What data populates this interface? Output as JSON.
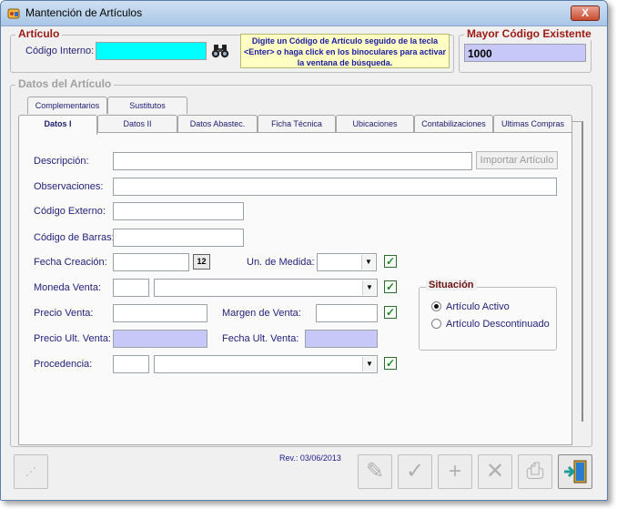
{
  "window": {
    "title": "Mantención de Artículos",
    "close_label": "X"
  },
  "articulo": {
    "group_title": "Artículo",
    "codigo_interno_label": "Código Interno:",
    "codigo_interno_value": "",
    "hint": "Digite un Código de Artículo seguido de la tecla <Enter> o haga click en los binoculares para activar la ventana de búsqueda."
  },
  "mayor_codigo": {
    "group_title": "Mayor Código Existente",
    "value": "1000"
  },
  "datos": {
    "group_title": "Datos del Artículo"
  },
  "tabs_back": [
    {
      "label": "Complementarios"
    },
    {
      "label": "Sustitutos"
    }
  ],
  "tabs_front": [
    {
      "label": "Datos I"
    },
    {
      "label": "Datos II"
    },
    {
      "label": "Datos Abastec."
    },
    {
      "label": "Ficha Técnica"
    },
    {
      "label": "Ubicaciones"
    },
    {
      "label": "Contabilizaciones"
    },
    {
      "label": "Ultimas Compras"
    }
  ],
  "form": {
    "descripcion_label": "Descripción:",
    "importar_button": "Importar Artículo",
    "observaciones_label": "Observaciones:",
    "codigo_externo_label": "Código Externo:",
    "codigo_barras_label": "Código de Barras:",
    "fecha_creacion_label": "Fecha Creación:",
    "calendar_glyph": "12",
    "un_medida_label": "Un. de Medida:",
    "moneda_venta_label": "Moneda Venta:",
    "precio_venta_label": "Precio Venta:",
    "margen_venta_label": "Margen de Venta:",
    "precio_ult_venta_label": "Precio Ult. Venta:",
    "fecha_ult_venta_label": "Fecha Ult. Venta:",
    "procedencia_label": "Procedencia:",
    "check_glyph": "✓",
    "combo_arrow": "▼"
  },
  "situacion": {
    "group_title": "Situación",
    "options": [
      {
        "label": "Artículo Activo",
        "selected": true
      },
      {
        "label": "Artículo Descontinuado",
        "selected": false
      }
    ]
  },
  "footer": {
    "revision": "Rev.: 03/06/2013",
    "buttons": [
      {
        "name": "size-grip-button",
        "glyph": "⋰"
      },
      {
        "name": "eraser-button",
        "glyph": "✎"
      },
      {
        "name": "accept-button",
        "glyph": "✓"
      },
      {
        "name": "add-button",
        "glyph": "+"
      },
      {
        "name": "delete-button",
        "glyph": "✕"
      },
      {
        "name": "print-button",
        "glyph": "⎙"
      },
      {
        "name": "exit-button",
        "glyph": "⇥"
      }
    ]
  },
  "colors": {
    "code_field": "#00ffff",
    "readonly_field": "#c8c8f8",
    "hint_bg": "#ffffc4",
    "group_title_red": "#9c1a12",
    "label_blue": "#22227a",
    "check_green": "#1c8a1c"
  }
}
